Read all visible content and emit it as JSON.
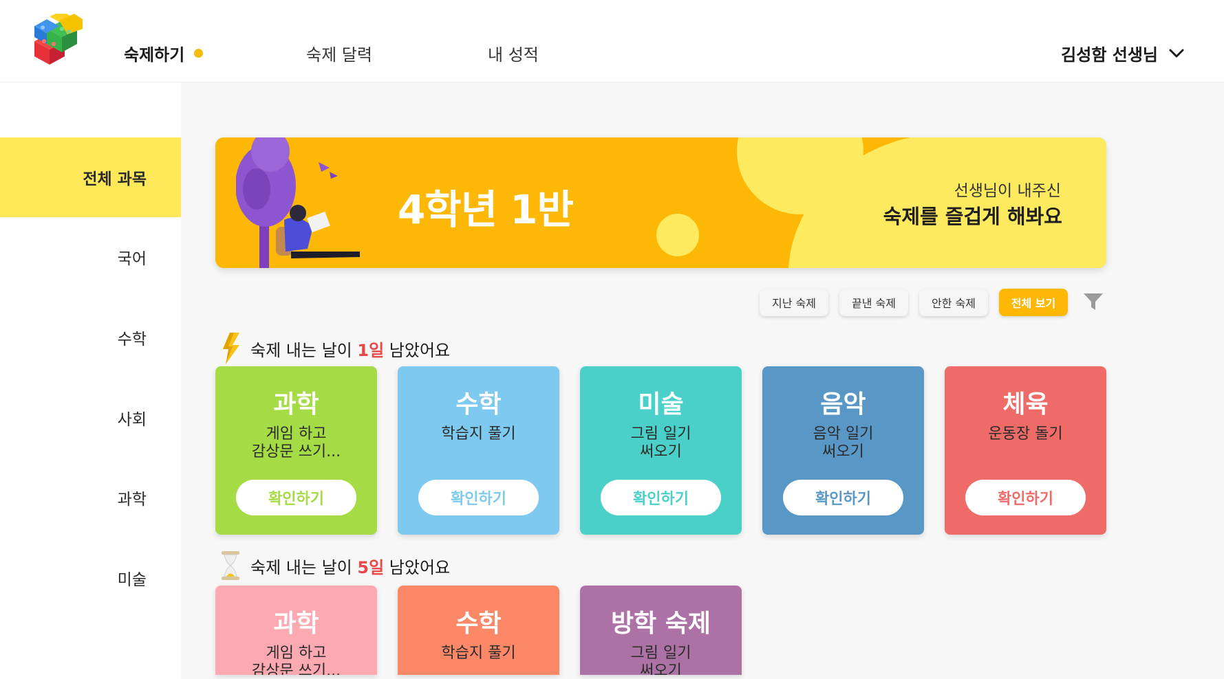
{
  "header": {
    "nav": [
      "숙제하기",
      "숙제 달력",
      "내 성적"
    ],
    "user": "김성함 선생님"
  },
  "sidebar": {
    "items": [
      "전체 과목",
      "국어",
      "수학",
      "사회",
      "과학",
      "미술"
    ]
  },
  "banner": {
    "title": "4학년 1반",
    "subtitle": "선생님이 내주신",
    "headline": "숙제를 즐겁게 해봐요"
  },
  "filters": [
    "지난 숙제",
    "끝낸 숙제",
    "안한 숙제",
    "전체 보기"
  ],
  "sections": [
    {
      "prefix": "숙제 내는 날이 ",
      "day": "1일",
      "suffix": " 남았어요",
      "cards": [
        {
          "subject": "과학",
          "desc": "게임 하고\n감상문 쓰기...",
          "button": "확인하기",
          "color": "#a5db44"
        },
        {
          "subject": "수학",
          "desc": "학습지 풀기",
          "button": "확인하기",
          "color": "#7ec9ef"
        },
        {
          "subject": "미술",
          "desc": "그림 일기\n써오기",
          "button": "확인하기",
          "color": "#4ad0c8"
        },
        {
          "subject": "음악",
          "desc": "음악 일기\n써오기",
          "button": "확인하기",
          "color": "#5998c6"
        },
        {
          "subject": "체육",
          "desc": "운동장 돌기",
          "button": "확인하기",
          "color": "#ee6b67"
        }
      ]
    },
    {
      "prefix": "숙제 내는 날이 ",
      "day": "5일",
      "suffix": " 남았어요",
      "cards": [
        {
          "subject": "과학",
          "desc": "게임 하고\n감상문 쓰기...",
          "color": "#fda9b2"
        },
        {
          "subject": "수학",
          "desc": "학습지 풀기",
          "color": "#fd8867"
        },
        {
          "subject": "방학 숙제",
          "desc": "그림 일기\n써오기",
          "color": "#ad72a5"
        }
      ]
    }
  ],
  "colors": {
    "accent": "#fdb806",
    "sidebar_active": "#fde85a",
    "highlight_day": "#e84848"
  },
  "icons": [
    "lego-logo-icon",
    "chevron-down-icon",
    "filter-icon",
    "lightning-icon",
    "hourglass-icon"
  ]
}
